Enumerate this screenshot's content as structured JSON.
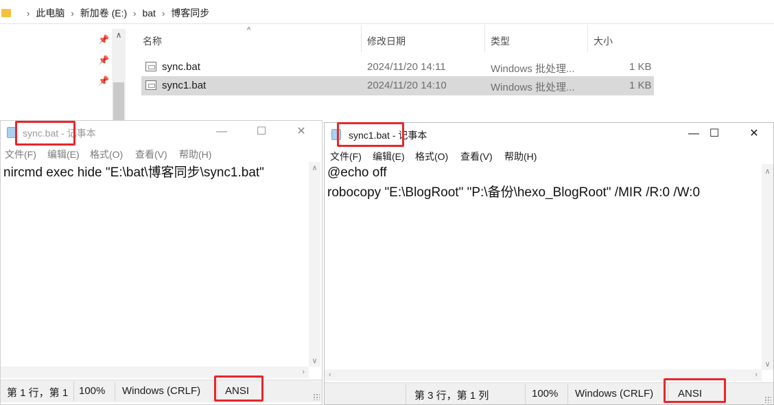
{
  "explorer": {
    "breadcrumb": [
      "此电脑",
      "新加卷 (E:)",
      "bat",
      "博客同步"
    ],
    "columns": {
      "name": "名称",
      "date": "修改日期",
      "type": "类型",
      "size": "大小"
    },
    "files": [
      {
        "name": "sync.bat",
        "date": "2024/11/20 14:11",
        "type": "Windows 批处理...",
        "size": "1 KB"
      },
      {
        "name": "sync1.bat",
        "date": "2024/11/20 14:10",
        "type": "Windows 批处理...",
        "size": "1 KB"
      }
    ]
  },
  "notepad_left": {
    "title": "sync.bat - 记事本",
    "menu": [
      "文件(F)",
      "编辑(E)",
      "格式(O)",
      "查看(V)",
      "帮助(H)"
    ],
    "content": "nircmd exec hide \"E:\\bat\\博客同步\\sync1.bat\"",
    "status": {
      "position": "第 1 行，第 1 ",
      "zoom": "100%",
      "line_ending": "Windows (CRLF)",
      "encoding": "ANSI"
    }
  },
  "notepad_right": {
    "title": "sync1.bat - 记事本",
    "menu": [
      "文件(F)",
      "编辑(E)",
      "格式(O)",
      "查看(V)",
      "帮助(H)"
    ],
    "content": "@echo off\nrobocopy \"E:\\BlogRoot\" \"P:\\备份\\hexo_BlogRoot\" /MIR /R:0 /W:0",
    "status": {
      "position": "第 3 行，第 1 列",
      "zoom": "100%",
      "line_ending": "Windows (CRLF)",
      "encoding": "ANSI"
    }
  },
  "icons": [
    "folder-icon",
    "pin-icon",
    "bat-file-icon",
    "notepad-icon",
    "minimize-icon",
    "maximize-icon",
    "close-icon",
    "sort-up-icon"
  ],
  "colors": {
    "annotation": "#e8262b",
    "selection": "#d9d9d9",
    "folder": "#f4c23e"
  }
}
